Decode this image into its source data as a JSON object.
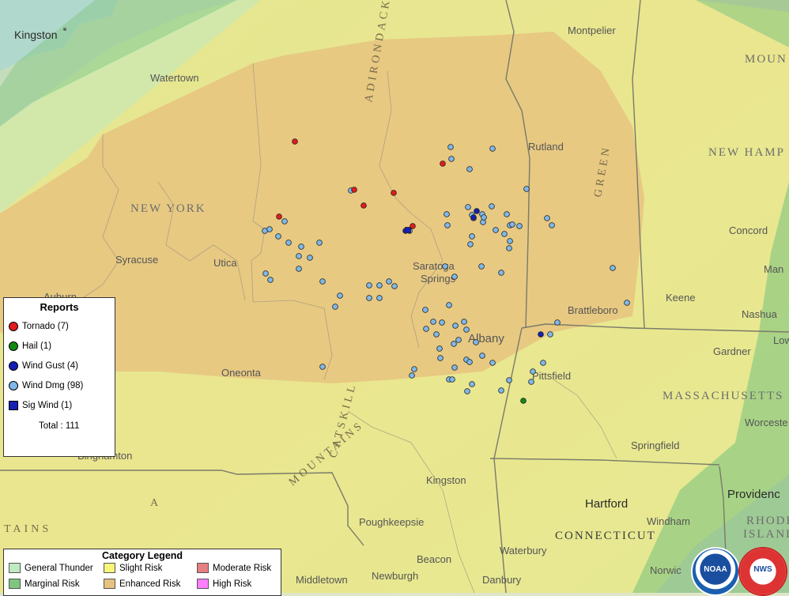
{
  "reports_legend": {
    "title": "Reports",
    "items": [
      {
        "label": "Tornado (7)",
        "color": "#e21b1b",
        "shape": "circle"
      },
      {
        "label": "Hail (1)",
        "color": "#128a12",
        "shape": "circle"
      },
      {
        "label": "Wind Gust (4)",
        "color": "#1420b4",
        "shape": "circle"
      },
      {
        "label": "Wind Dmg (98)",
        "color": "#7fb8e8",
        "shape": "circle"
      },
      {
        "label": "Sig Wind (1)",
        "color": "#1420b4",
        "shape": "square"
      }
    ],
    "total": "Total : 111"
  },
  "category_legend": {
    "title": "Category Legend",
    "items": [
      {
        "label": "General Thunder",
        "color": "#c1e9c1"
      },
      {
        "label": "Slight Risk",
        "color": "#f6f67b"
      },
      {
        "label": "Moderate Risk",
        "color": "#e67f7f"
      },
      {
        "label": "Marginal Risk",
        "color": "#7fc57f"
      },
      {
        "label": "Enhanced Risk",
        "color": "#e6c27f"
      },
      {
        "label": "High Risk",
        "color": "#ff7fff"
      }
    ]
  },
  "places": {
    "kingston_ny_north": "Kingston",
    "watertown": "Watertown",
    "montpelier": "Montpelier",
    "rutland": "Rutland",
    "new_york": "NEW YORK",
    "syracuse": "Syracuse",
    "utica": "Utica",
    "saratoga": "Saratoga",
    "springs": "Springs",
    "albany": "Albany",
    "oneonta": "Oneonta",
    "pittsfield": "Pittsfield",
    "brattleboro": "Brattleboro",
    "keene": "Keene",
    "concord": "Concord",
    "nashua": "Nashua",
    "gardner": "Gardner",
    "massachusetts": "MASSACHUSETTS",
    "worcester": "Worceste",
    "springfield": "Springfield",
    "binghamton": "Binghamton",
    "kingston": "Kingston",
    "poughkeepsie": "Poughkeepsie",
    "hartford": "Hartford",
    "windham": "Windham",
    "connecticut": "CONNECTICUT",
    "waterbury": "Waterbury",
    "providence": "Providenc",
    "rhode": "RHODE",
    "island": "ISLAND",
    "beacon": "Beacon",
    "newburgh": "Newburgh",
    "middletown": "Middletown",
    "danbury": "Danbury",
    "norwich": "Norwic",
    "new_hamp": "NEW HAMP",
    "mount": "MOUN",
    "low": "Low",
    "man": "Man",
    "auburn": "Auburn",
    "tains": "TAINS",
    "a_letter": "A",
    "mountains_cat": "MOUNTAINS",
    "catskill": "CATSKILL",
    "green": "GREEN",
    "adirondack": "ADIRONDACK"
  },
  "logos": {
    "noaa": "NOAA",
    "nws": "NWS"
  },
  "reports": {
    "wind_dmg": [
      [
        570,
        186
      ],
      [
        571,
        201
      ],
      [
        594,
        214
      ],
      [
        623,
        188
      ],
      [
        666,
        239
      ],
      [
        565,
        271
      ],
      [
        566,
        285
      ],
      [
        592,
        262
      ],
      [
        597,
        272
      ],
      [
        599,
        276
      ],
      [
        610,
        271
      ],
      [
        611,
        281
      ],
      [
        612,
        275
      ],
      [
        622,
        261
      ],
      [
        641,
        271
      ],
      [
        645,
        285
      ],
      [
        648,
        284
      ],
      [
        657,
        286
      ],
      [
        627,
        291
      ],
      [
        638,
        296
      ],
      [
        597,
        299
      ],
      [
        595,
        309
      ],
      [
        645,
        305
      ],
      [
        644,
        314
      ],
      [
        609,
        337
      ],
      [
        634,
        345
      ],
      [
        563,
        337
      ],
      [
        575,
        350
      ],
      [
        538,
        392
      ],
      [
        568,
        386
      ],
      [
        587,
        407
      ],
      [
        559,
        408
      ],
      [
        548,
        407
      ],
      [
        539,
        416
      ],
      [
        552,
        423
      ],
      [
        576,
        412
      ],
      [
        590,
        417
      ],
      [
        580,
        430
      ],
      [
        574,
        435
      ],
      [
        556,
        441
      ],
      [
        557,
        453
      ],
      [
        602,
        433
      ],
      [
        590,
        455
      ],
      [
        594,
        458
      ],
      [
        610,
        450
      ],
      [
        623,
        459
      ],
      [
        575,
        465
      ],
      [
        568,
        480
      ],
      [
        572,
        480
      ],
      [
        597,
        486
      ],
      [
        591,
        495
      ],
      [
        634,
        494
      ],
      [
        644,
        481
      ],
      [
        672,
        483
      ],
      [
        674,
        470
      ],
      [
        687,
        459
      ],
      [
        705,
        408
      ],
      [
        696,
        423
      ],
      [
        692,
        276
      ],
      [
        698,
        285
      ],
      [
        775,
        339
      ],
      [
        793,
        383
      ],
      [
        518,
        292
      ],
      [
        444,
        241
      ],
      [
        360,
        280
      ],
      [
        335,
        292
      ],
      [
        341,
        290
      ],
      [
        352,
        299
      ],
      [
        365,
        307
      ],
      [
        381,
        312
      ],
      [
        378,
        324
      ],
      [
        392,
        326
      ],
      [
        404,
        307
      ],
      [
        378,
        340
      ],
      [
        336,
        346
      ],
      [
        342,
        354
      ],
      [
        408,
        356
      ],
      [
        430,
        374
      ],
      [
        424,
        388
      ],
      [
        467,
        361
      ],
      [
        480,
        361
      ],
      [
        492,
        356
      ],
      [
        499,
        362
      ],
      [
        467,
        377
      ],
      [
        480,
        377
      ],
      [
        524,
        467
      ],
      [
        521,
        475
      ],
      [
        408,
        464
      ]
    ],
    "tornado": [
      [
        373,
        179
      ],
      [
        560,
        207
      ],
      [
        448,
        240
      ],
      [
        498,
        244
      ],
      [
        460,
        260
      ],
      [
        353,
        274
      ],
      [
        522,
        286
      ]
    ],
    "hail": [
      [
        662,
        507
      ]
    ],
    "wind_gust": [
      [
        603,
        267
      ],
      [
        599,
        275
      ],
      [
        513,
        292
      ],
      [
        684,
        423
      ]
    ],
    "sig_wind": [
      [
        516,
        291
      ]
    ]
  }
}
